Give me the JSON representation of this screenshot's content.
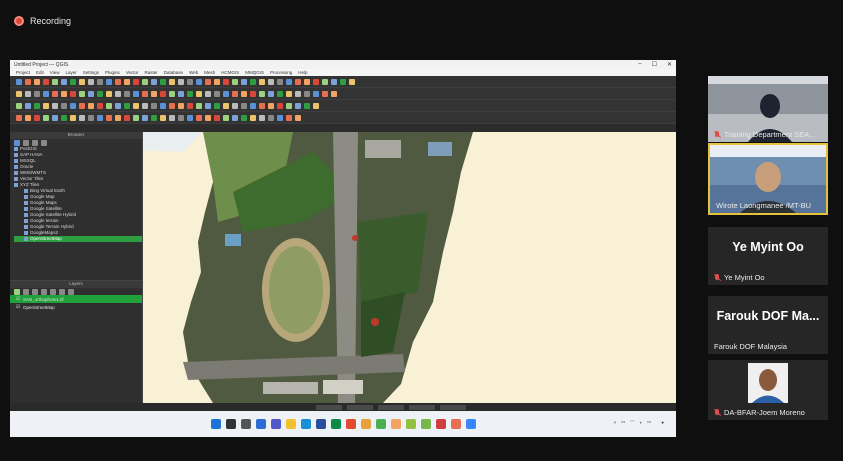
{
  "recording": {
    "label": "Recording"
  },
  "qgis": {
    "window_title": "Untitled Project — QGIS",
    "menu": [
      "Project",
      "Edit",
      "View",
      "Layer",
      "Settings",
      "Plugins",
      "Vector",
      "Raster",
      "Database",
      "Web",
      "Mesh",
      "HCMGIS",
      "MMQGIS",
      "Processing",
      "Help"
    ],
    "browser_panel": {
      "title": "Browser",
      "items": [
        {
          "label": "PostGIS",
          "indent": 0
        },
        {
          "label": "SAP HANA",
          "indent": 0
        },
        {
          "label": "MSSQL",
          "indent": 0
        },
        {
          "label": "Oracle",
          "indent": 0
        },
        {
          "label": "WMS/WMTS",
          "indent": 0
        },
        {
          "label": "Vector Tiles",
          "indent": 0
        },
        {
          "label": "XYZ Tiles",
          "indent": 0
        },
        {
          "label": "Bing Virtual Earth",
          "indent": 1
        },
        {
          "label": "Google Map",
          "indent": 1
        },
        {
          "label": "Google Maps",
          "indent": 1
        },
        {
          "label": "Google Satellite",
          "indent": 1
        },
        {
          "label": "Google Satellite Hybrid",
          "indent": 1
        },
        {
          "label": "Google terrain",
          "indent": 1
        },
        {
          "label": "Google Terrain Hybrid",
          "indent": 1
        },
        {
          "label": "GoogleMaps2",
          "indent": 1
        },
        {
          "label": "OpenStreetMap",
          "indent": 1,
          "selected": true
        }
      ]
    },
    "layers_panel": {
      "title": "Layers",
      "layers": [
        {
          "label": "SAN_orthophoto1.tif",
          "selected": true
        },
        {
          "label": "OpenStreetMap",
          "selected": false
        }
      ]
    }
  },
  "participants": [
    {
      "name": "Training Department SEA...",
      "muted": true
    },
    {
      "name": "Wirote Laongmanee /MT-BU",
      "muted": false,
      "active": true
    },
    {
      "display": "Ye Myint Oo",
      "name": "Ye Myint Oo",
      "muted": true
    },
    {
      "display": "Farouk DOF Ma...",
      "name": "Farouk DOF Malaysia",
      "muted": false
    },
    {
      "name": "DA-BFAR-Joem Moreno",
      "muted": true
    }
  ],
  "colors": {
    "accent": "#2d9f41",
    "mic_off": "#e24c4c",
    "highlight": "#e6c23a",
    "rec": "#d9463a"
  }
}
